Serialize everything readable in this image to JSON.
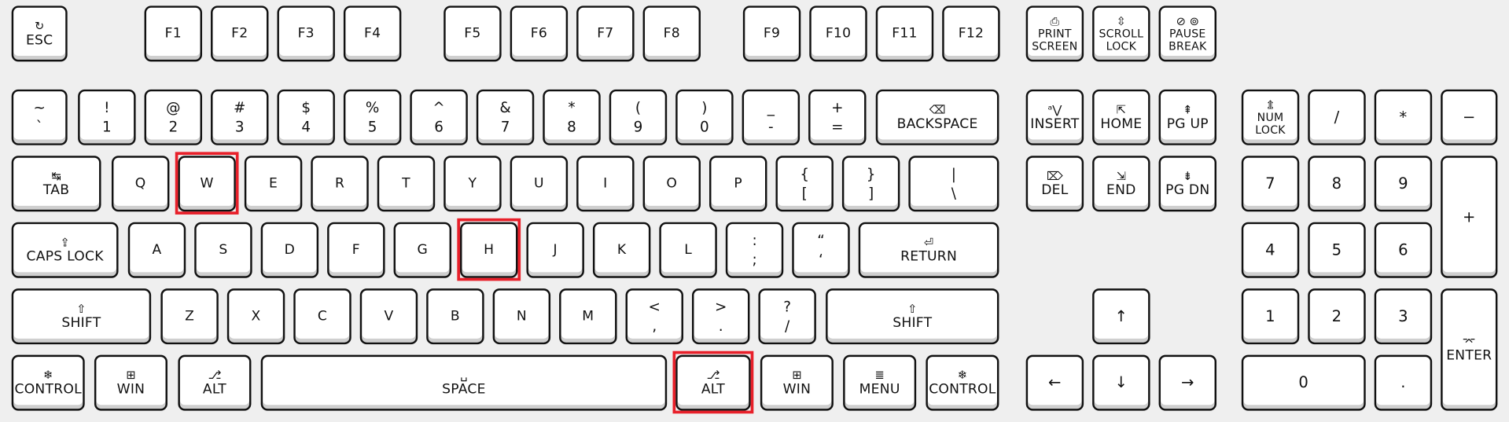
{
  "highlight_color": "#e8202a",
  "keys": [
    {
      "id": "esc",
      "label": "ESC",
      "icon": "↻",
      "icon_name": "restart-icon"
    },
    {
      "id": "f1",
      "label": "F1"
    },
    {
      "id": "f2",
      "label": "F2"
    },
    {
      "id": "f3",
      "label": "F3"
    },
    {
      "id": "f4",
      "label": "F4"
    },
    {
      "id": "f5",
      "label": "F5"
    },
    {
      "id": "f6",
      "label": "F6"
    },
    {
      "id": "f7",
      "label": "F7"
    },
    {
      "id": "f8",
      "label": "F8"
    },
    {
      "id": "f9",
      "label": "F9"
    },
    {
      "id": "f10",
      "label": "F10"
    },
    {
      "id": "f11",
      "label": "F11"
    },
    {
      "id": "f12",
      "label": "F12"
    },
    {
      "id": "print",
      "label": "PRINT\nSCREEN",
      "icon": "⎙",
      "icon_name": "print-screen-icon",
      "small": true
    },
    {
      "id": "scroll",
      "label": "SCROLL\nLOCK",
      "icon": "⇳",
      "icon_name": "scroll-lock-icon",
      "small": true
    },
    {
      "id": "pause",
      "label": "PAUSE\nBREAK",
      "icon": "⊘ ⊚",
      "icon_name": "pause-break-icon",
      "small": true
    },
    {
      "id": "tilde",
      "top": "~",
      "bottom": "`"
    },
    {
      "id": "1",
      "top": "!",
      "bottom": "1"
    },
    {
      "id": "2",
      "top": "@",
      "bottom": "2"
    },
    {
      "id": "3",
      "top": "#",
      "bottom": "3"
    },
    {
      "id": "4",
      "top": "$",
      "bottom": "4"
    },
    {
      "id": "5",
      "top": "%",
      "bottom": "5"
    },
    {
      "id": "6",
      "top": "^",
      "bottom": "6"
    },
    {
      "id": "7",
      "top": "&",
      "bottom": "7"
    },
    {
      "id": "8",
      "top": "*",
      "bottom": "8"
    },
    {
      "id": "9",
      "top": "(",
      "bottom": "9"
    },
    {
      "id": "0",
      "top": ")",
      "bottom": "0"
    },
    {
      "id": "minus",
      "top": "_",
      "bottom": "-"
    },
    {
      "id": "equal",
      "top": "+",
      "bottom": "="
    },
    {
      "id": "backspace",
      "label": "BACKSPACE",
      "icon": "⌫",
      "icon_name": "backspace-icon"
    },
    {
      "id": "insert",
      "label": "INSERT",
      "icon": "ᵃ⋁",
      "icon_name": "insert-icon"
    },
    {
      "id": "home",
      "label": "HOME",
      "icon": "⇱",
      "icon_name": "home-icon"
    },
    {
      "id": "pgup",
      "label": "PG UP",
      "icon": "⇞",
      "icon_name": "page-up-icon"
    },
    {
      "id": "numlock",
      "label": "NUM\nLOCK",
      "icon": "⇭",
      "icon_name": "num-lock-icon",
      "small": true
    },
    {
      "id": "kpdiv",
      "label": "/",
      "big": true
    },
    {
      "id": "kpmul",
      "label": "*",
      "big": true
    },
    {
      "id": "kpsub",
      "label": "−",
      "big": true
    },
    {
      "id": "tab",
      "label": "TAB",
      "icon": "↹",
      "icon_name": "tab-icon"
    },
    {
      "id": "q",
      "label": "Q"
    },
    {
      "id": "w",
      "label": "W",
      "highlighted": true
    },
    {
      "id": "e",
      "label": "E"
    },
    {
      "id": "r",
      "label": "R"
    },
    {
      "id": "t",
      "label": "T"
    },
    {
      "id": "y",
      "label": "Y"
    },
    {
      "id": "u",
      "label": "U"
    },
    {
      "id": "i",
      "label": "I"
    },
    {
      "id": "o",
      "label": "O"
    },
    {
      "id": "p",
      "label": "P"
    },
    {
      "id": "lbrace",
      "top": "{",
      "bottom": "["
    },
    {
      "id": "rbrace",
      "top": "}",
      "bottom": "]"
    },
    {
      "id": "pipe",
      "top": "|",
      "bottom": "\\"
    },
    {
      "id": "del",
      "label": "DEL",
      "icon": "⌦",
      "icon_name": "delete-icon"
    },
    {
      "id": "end",
      "label": "END",
      "icon": "⇲",
      "icon_name": "end-icon"
    },
    {
      "id": "pgdn",
      "label": "PG DN",
      "icon": "⇟",
      "icon_name": "page-down-icon"
    },
    {
      "id": "kp7",
      "label": "7",
      "big": true
    },
    {
      "id": "kp8",
      "label": "8",
      "big": true
    },
    {
      "id": "kp9",
      "label": "9",
      "big": true
    },
    {
      "id": "kpadd",
      "label": "+",
      "big": true
    },
    {
      "id": "caps",
      "label": "CAPS LOCK",
      "icon": "⇪",
      "icon_name": "caps-lock-icon"
    },
    {
      "id": "a",
      "label": "A"
    },
    {
      "id": "s",
      "label": "S"
    },
    {
      "id": "d",
      "label": "D"
    },
    {
      "id": "f",
      "label": "F"
    },
    {
      "id": "g",
      "label": "G"
    },
    {
      "id": "h",
      "label": "H",
      "highlighted": true
    },
    {
      "id": "j",
      "label": "J"
    },
    {
      "id": "k",
      "label": "K"
    },
    {
      "id": "l",
      "label": "L"
    },
    {
      "id": "semicolon",
      "top": ":",
      "bottom": ";"
    },
    {
      "id": "quote",
      "top": "“",
      "bottom": "‘"
    },
    {
      "id": "return",
      "label": "RETURN",
      "icon": "⏎",
      "icon_name": "return-icon"
    },
    {
      "id": "kp4",
      "label": "4",
      "big": true
    },
    {
      "id": "kp5",
      "label": "5",
      "big": true
    },
    {
      "id": "kp6",
      "label": "6",
      "big": true
    },
    {
      "id": "lshift",
      "label": "SHIFT",
      "icon": "⇧",
      "icon_name": "shift-icon"
    },
    {
      "id": "z",
      "label": "Z"
    },
    {
      "id": "x",
      "label": "X"
    },
    {
      "id": "c",
      "label": "C"
    },
    {
      "id": "v",
      "label": "V"
    },
    {
      "id": "b",
      "label": "B"
    },
    {
      "id": "n",
      "label": "N"
    },
    {
      "id": "m",
      "label": "M"
    },
    {
      "id": "comma",
      "top": "<",
      "bottom": ","
    },
    {
      "id": "period",
      "top": ">",
      "bottom": "."
    },
    {
      "id": "slash",
      "top": "?",
      "bottom": "/"
    },
    {
      "id": "rshift",
      "label": "SHIFT",
      "icon": "⇧",
      "icon_name": "shift-icon"
    },
    {
      "id": "up",
      "label": "↑",
      "big": true
    },
    {
      "id": "kp1",
      "label": "1",
      "big": true
    },
    {
      "id": "kp2",
      "label": "2",
      "big": true
    },
    {
      "id": "kp3",
      "label": "3",
      "big": true
    },
    {
      "id": "kpenter",
      "label": "ENTER",
      "icon": "⌤",
      "icon_name": "enter-icon"
    },
    {
      "id": "lctrl",
      "label": "CONTROL",
      "icon": "❄",
      "icon_name": "control-icon"
    },
    {
      "id": "lwin",
      "label": "WIN",
      "icon": "⊞",
      "icon_name": "windows-icon"
    },
    {
      "id": "lalt",
      "label": "ALT",
      "icon": "⎇",
      "icon_name": "alt-icon"
    },
    {
      "id": "space",
      "label": "SPACE",
      "icon": "␣",
      "icon_name": "space-icon"
    },
    {
      "id": "ralt",
      "label": "ALT",
      "icon": "⎇",
      "icon_name": "alt-icon",
      "highlighted": true
    },
    {
      "id": "rwin",
      "label": "WIN",
      "icon": "⊞",
      "icon_name": "windows-icon"
    },
    {
      "id": "menu",
      "label": "MENU",
      "icon": "≣",
      "icon_name": "menu-icon"
    },
    {
      "id": "rctrl",
      "label": "CONTROL",
      "icon": "❄",
      "icon_name": "control-icon"
    },
    {
      "id": "left",
      "label": "←",
      "big": true
    },
    {
      "id": "down",
      "label": "↓",
      "big": true
    },
    {
      "id": "right",
      "label": "→",
      "big": true
    },
    {
      "id": "kp0",
      "label": "0",
      "big": true
    },
    {
      "id": "kpdot",
      "label": ".",
      "big": true
    }
  ]
}
